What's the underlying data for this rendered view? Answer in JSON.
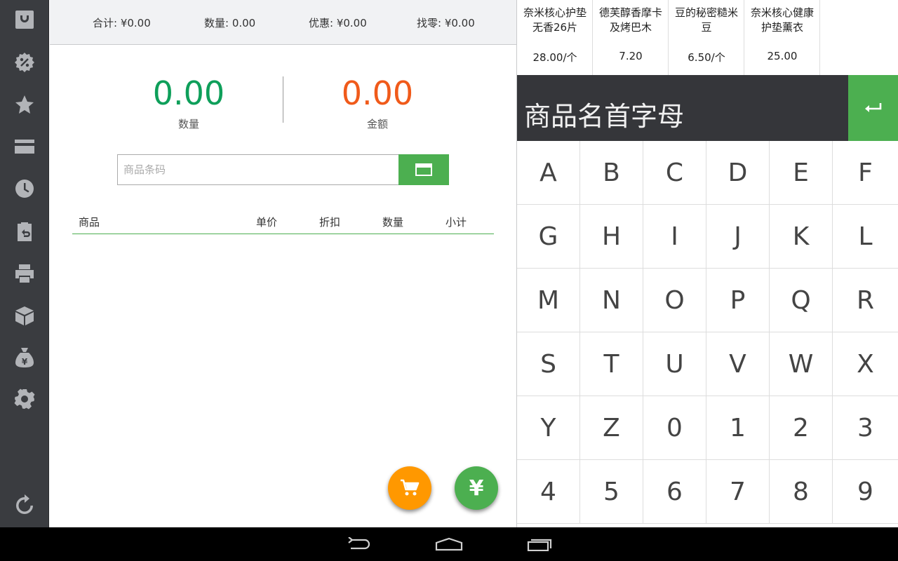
{
  "summary": {
    "total": "合计: ¥0.00",
    "quantity": "数量: 0.00",
    "discount": "优惠: ¥0.00",
    "change": "找零: ¥0.00"
  },
  "stats": {
    "quantity_value": "0.00",
    "quantity_label": "数量",
    "amount_value": "0.00",
    "amount_label": "金额",
    "quantity_color": "#0e9f5a",
    "amount_color": "#f05a1a"
  },
  "barcode": {
    "placeholder": "商品条码"
  },
  "table": {
    "columns": [
      "商品",
      "单价",
      "折扣",
      "数量",
      "小计"
    ]
  },
  "products": [
    {
      "name": "奈米核心护垫无香26片",
      "price": "28.00/个"
    },
    {
      "name": "德芙醇香摩卡及烤巴木",
      "price": "7.20"
    },
    {
      "name": "豆的秘密糙米豆",
      "price": "6.50/个"
    },
    {
      "name": "奈米核心健康护垫薰衣",
      "price": "25.00"
    }
  ],
  "keyboard": {
    "title": "商品名首字母",
    "keys": [
      "A",
      "B",
      "C",
      "D",
      "E",
      "F",
      "G",
      "H",
      "I",
      "J",
      "K",
      "L",
      "M",
      "N",
      "O",
      "P",
      "Q",
      "R",
      "S",
      "T",
      "U",
      "V",
      "W",
      "X",
      "Y",
      "Z",
      "0",
      "1",
      "2",
      "3",
      "4",
      "5",
      "6",
      "7",
      "8",
      "9"
    ]
  },
  "colors": {
    "accent": "#4caf50",
    "orange": "#ff9800",
    "sidebar": "#3a3c40"
  },
  "sidebar_icons": [
    "bag-icon",
    "discount-icon",
    "star-icon",
    "card-icon",
    "clock-icon",
    "return-icon",
    "print-icon",
    "box-icon",
    "money-bag-icon",
    "gear-icon",
    "refresh-icon"
  ]
}
